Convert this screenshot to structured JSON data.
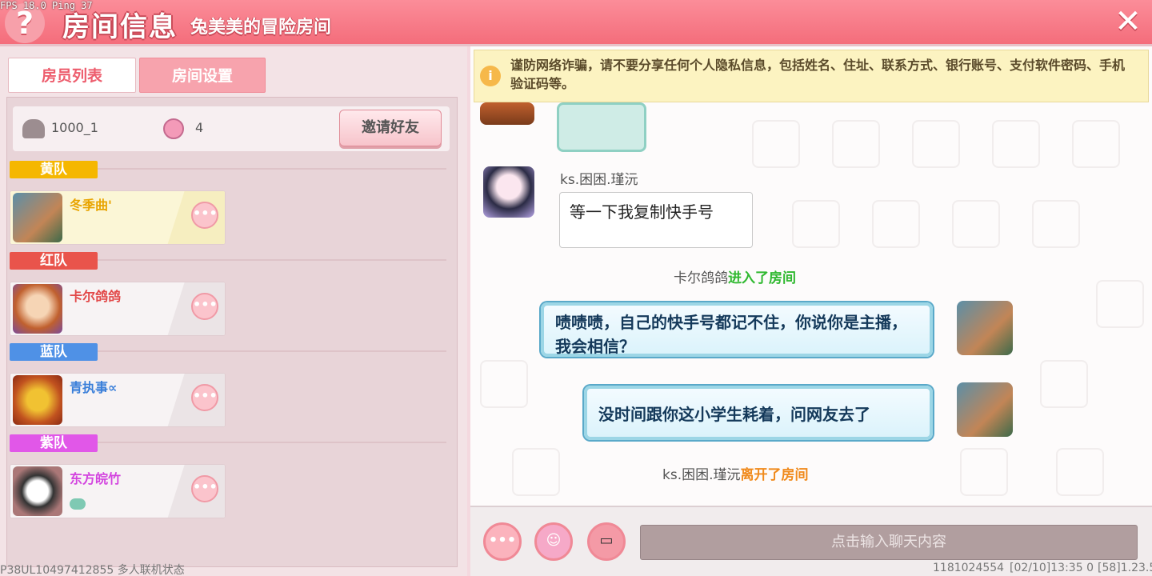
{
  "header": {
    "fps_text": "FPS 18.0  Ping 37",
    "help_glyph": "?",
    "title": "房间信息",
    "subtitle": "兔美美的冒险房间",
    "close_glyph": "✕"
  },
  "tabs": [
    {
      "label": "房员列表",
      "active": true
    },
    {
      "label": "房间设置",
      "active": false
    }
  ],
  "room": {
    "id": "1000_1",
    "member_count": "4",
    "invite_label": "邀请好友"
  },
  "teams": [
    {
      "name": "黄队",
      "color": "#f5b700",
      "players": [
        {
          "name": "冬季曲'",
          "name_color": "#e8a400"
        }
      ]
    },
    {
      "name": "红队",
      "color": "#e9544b",
      "players": [
        {
          "name": "卡尔鸽鸽",
          "name_color": "#e24848"
        }
      ]
    },
    {
      "name": "蓝队",
      "color": "#4f91e6",
      "players": [
        {
          "name": "青执事∝",
          "name_color": "#3a7fd9"
        }
      ]
    },
    {
      "name": "紫队",
      "color": "#e157e8",
      "players": [
        {
          "name": "东方皖竹",
          "name_color": "#d344df"
        }
      ]
    }
  ],
  "more_glyph": "•••",
  "debug_text": "P38UL10497412855 多人联机状态",
  "warning": {
    "icon": "i",
    "text": "谨防网络诈骗，请不要分享任何个人隐私信息，包括姓名、住址、联系方式、银行账号、支付软件密码、手机验证码等。"
  },
  "chat": {
    "msg1_sender": "ks.困困.瑾沅",
    "msg1_text": "等一下我复制快手号",
    "sys1_name": "卡尔鸽鸽",
    "sys1_action": "进入了房间",
    "msg2_text": "啧啧啧，自己的快手号都记不住，你说你是主播，我会相信？",
    "msg3_text": "没时间跟你这小学生耗着，问网友去了",
    "sys2_name": "ks.困困.瑾沅",
    "sys2_action": "离开了房间"
  },
  "input": {
    "placeholder": "点击输入聊天内容",
    "more_glyph": "•••",
    "emoji_glyph": "☺",
    "card_glyph": "▭"
  },
  "footer": {
    "id": "1181024554",
    "time": "[02/10]13:35 0",
    "version": "[58]1.23.5"
  },
  "colors": {
    "header": "#f46d7b",
    "enter": "#2fb82f",
    "leave": "#f08a1c"
  }
}
